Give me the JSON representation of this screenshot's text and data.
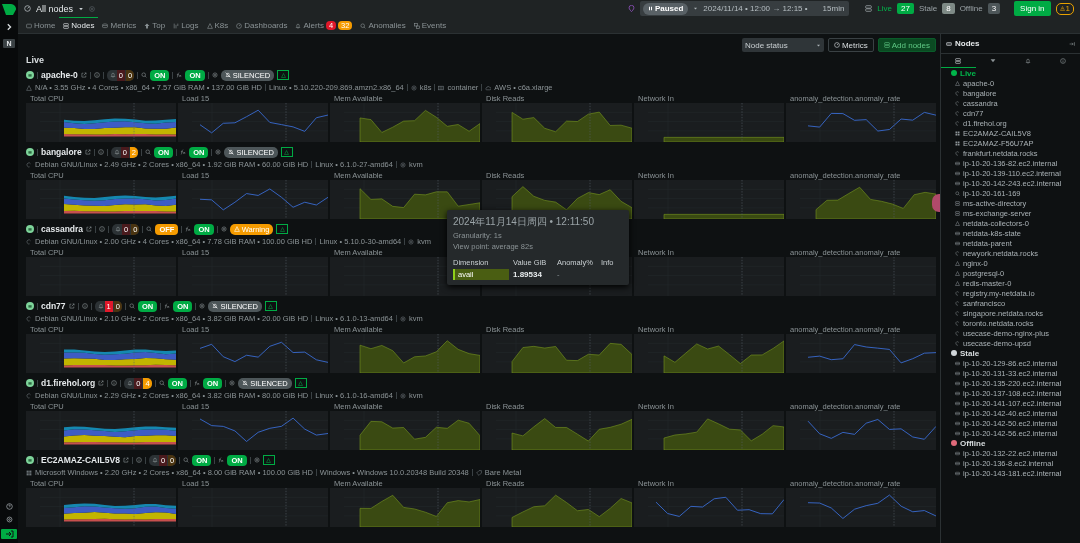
{
  "header": {
    "scope": "All nodes",
    "playback": {
      "label": "Paused",
      "paused": true
    },
    "range": "2024/11/14 • 12:00 → 12:15 •",
    "duration": "15min",
    "counts": [
      {
        "label": "Live",
        "value": "27",
        "kind": "live"
      },
      {
        "label": "Stale",
        "value": "8",
        "kind": "stale"
      },
      {
        "label": "Offline",
        "value": "3",
        "kind": "offline"
      }
    ],
    "sign_in": "Sign in",
    "warnings": "1"
  },
  "tabs": [
    {
      "label": "Home",
      "selected": false
    },
    {
      "label": "Nodes",
      "selected": true
    },
    {
      "label": "Metrics",
      "selected": false
    },
    {
      "label": "Top",
      "selected": false
    },
    {
      "label": "Logs",
      "selected": false
    },
    {
      "label": "K8s",
      "selected": false
    },
    {
      "label": "Dashboards",
      "selected": false
    },
    {
      "label": "Alerts",
      "selected": false,
      "badges": [
        {
          "text": "4",
          "kind": "critical"
        },
        {
          "text": "32",
          "kind": "warning"
        }
      ]
    },
    {
      "label": "Anomalies",
      "selected": false
    },
    {
      "label": "Events",
      "selected": false
    }
  ],
  "rail": {
    "space": "N"
  },
  "toolbar": {
    "group_by": "Node status",
    "metrics": "Metrics",
    "add_nodes": "Add nodes"
  },
  "section": "Live",
  "nodes": [
    {
      "name": "apache-0",
      "critical": {
        "count": "0",
        "active": false
      },
      "warning": {
        "count": "0",
        "active": false
      },
      "ml": {
        "label": "ON",
        "on": true
      },
      "fn": {
        "label": "ON",
        "on": true
      },
      "badge": {
        "kind": "silenced",
        "label": "SILENCED"
      },
      "info": [
        {
          "kind": "k8s",
          "text": "N/A • 3.55 GHz • 4 Cores • x86_64 • 7.57 GiB RAM • 137.00 GiB HD"
        },
        {
          "kind": "kernel",
          "text": "Linux • 5.10.220-209.869.amzn2.x86_64"
        },
        {
          "kind": "virt",
          "text": "k8s"
        },
        {
          "kind": "container",
          "text": "container"
        },
        {
          "kind": "cloud",
          "text": "AWS • c6a.xlarge"
        }
      ],
      "charts": [
        {
          "title": "Total CPU",
          "kind": "stacked"
        },
        {
          "title": "Load 15",
          "kind": "line"
        },
        {
          "title": "Mem Available",
          "kind": "area"
        },
        {
          "title": "Disk Reads",
          "kind": "area"
        },
        {
          "title": "Network In",
          "kind": "flat"
        },
        {
          "title": "anomaly_detection.anomaly_rate",
          "kind": "line"
        }
      ]
    },
    {
      "name": "bangalore",
      "critical": {
        "count": "0",
        "active": false
      },
      "warning": {
        "count": "2",
        "active": true
      },
      "ml": {
        "label": "ON",
        "on": true
      },
      "fn": {
        "label": "ON",
        "on": true
      },
      "badge": {
        "kind": "silenced",
        "label": "SILENCED"
      },
      "info": [
        {
          "kind": "debian",
          "text": "Debian GNU/Linux • 2.49 GHz • 2 Cores • x86_64 • 1.92 GiB RAM • 60.00 GiB HD"
        },
        {
          "kind": "kernel",
          "text": "Linux • 6.1.0-27-amd64"
        },
        {
          "kind": "virt",
          "text": "kvm"
        }
      ],
      "charts": [
        {
          "title": "Total CPU",
          "kind": "stacked"
        },
        {
          "title": "Load 15",
          "kind": "line"
        },
        {
          "title": "Mem Available",
          "kind": "area"
        },
        {
          "title": "Disk Reads",
          "kind": "area"
        },
        {
          "title": "Network In",
          "kind": "flat"
        },
        {
          "title": "anomaly_detection.anomaly_rate",
          "kind": "area"
        }
      ]
    },
    {
      "name": "cassandra",
      "critical": {
        "count": "0",
        "active": false
      },
      "warning": {
        "count": "0",
        "active": false
      },
      "ml": {
        "label": "OFF",
        "on": false
      },
      "fn": {
        "label": "ON",
        "on": true
      },
      "badge": {
        "kind": "warning",
        "label": "Warning"
      },
      "info": [
        {
          "kind": "debian",
          "text": "Debian GNU/Linux • 2.00 GHz • 4 Cores • x86_64 • 7.78 GiB RAM • 100.00 GiB HD"
        },
        {
          "kind": "kernel",
          "text": "Linux • 5.10.0-30-amd64"
        },
        {
          "kind": "virt",
          "text": "kvm"
        }
      ],
      "charts": [
        {
          "title": "Total CPU",
          "kind": "empty"
        },
        {
          "title": "Load 15",
          "kind": "empty"
        },
        {
          "title": "Mem Available",
          "kind": "empty"
        },
        {
          "kind": "empty"
        },
        {
          "title": "Network In",
          "kind": "empty"
        },
        {
          "title": "anomaly_detection.anomaly_rate",
          "kind": "empty"
        }
      ]
    },
    {
      "name": "cdn77",
      "critical": {
        "count": "1",
        "active": true
      },
      "warning": {
        "count": "0",
        "active": false
      },
      "ml": {
        "label": "ON",
        "on": true
      },
      "fn": {
        "label": "ON",
        "on": true
      },
      "badge": {
        "kind": "silenced",
        "label": "SILENCED"
      },
      "info": [
        {
          "kind": "debian",
          "text": "Debian GNU/Linux • 2.10 GHz • 2 Cores • x86_64 • 3.82 GiB RAM • 20.00 GiB HD"
        },
        {
          "kind": "kernel",
          "text": "Linux • 6.1.0-13-amd64"
        },
        {
          "kind": "virt",
          "text": "kvm"
        }
      ],
      "charts": [
        {
          "title": "Total CPU",
          "kind": "stacked"
        },
        {
          "title": "Load 15",
          "kind": "line"
        },
        {
          "title": "Mem Available",
          "kind": "area"
        },
        {
          "title": "Disk Reads",
          "kind": "area"
        },
        {
          "title": "Network In",
          "kind": "area"
        },
        {
          "title": "anomaly_detection.anomaly_rate",
          "kind": "line"
        }
      ]
    },
    {
      "name": "d1.firehol.org",
      "critical": {
        "count": "0",
        "active": false
      },
      "warning": {
        "count": "4",
        "active": true
      },
      "ml": {
        "label": "ON",
        "on": true
      },
      "fn": {
        "label": "ON",
        "on": true
      },
      "badge": {
        "kind": "silenced",
        "label": "SILENCED"
      },
      "info": [
        {
          "kind": "debian",
          "text": "Debian GNU/Linux • 2.29 GHz • 2 Cores • x86_64 • 3.82 GiB RAM • 80.00 GiB HD"
        },
        {
          "kind": "kernel",
          "text": "Linux • 6.1.0-16-amd64"
        },
        {
          "kind": "virt",
          "text": "kvm"
        }
      ],
      "charts": [
        {
          "title": "Total CPU",
          "kind": "stacked"
        },
        {
          "title": "Load 15",
          "kind": "line"
        },
        {
          "title": "Mem Available",
          "kind": "area"
        },
        {
          "title": "Disk Reads",
          "kind": "area"
        },
        {
          "title": "Network In",
          "kind": "area"
        },
        {
          "title": "anomaly_detection.anomaly_rate",
          "kind": "line"
        }
      ]
    },
    {
      "name": "EC2AMAZ-CAIL5V8",
      "critical": {
        "count": "0",
        "active": false
      },
      "warning": {
        "count": "0",
        "active": false
      },
      "ml": {
        "label": "ON",
        "on": true
      },
      "fn": {
        "label": "ON",
        "on": true
      },
      "info": [
        {
          "kind": "windows",
          "text": "Microsoft Windows • 2.20 GHz • 2 Cores • x86_64 • 8.00 GiB RAM • 100.00 GiB HD"
        },
        {
          "kind": "kernel",
          "text": "Windows • Windows 10.0.20348 Build 20348"
        },
        {
          "kind": "tag",
          "text": "Bare Metal"
        }
      ],
      "charts": [
        {
          "title": "Total CPU",
          "kind": "stacked"
        },
        {
          "title": "Load 15",
          "kind": "empty"
        },
        {
          "title": "Mem Available",
          "kind": "area"
        },
        {
          "title": "Disk Reads",
          "kind": "area"
        },
        {
          "title": "Network In",
          "kind": "line"
        },
        {
          "title": "anomaly_detection.anomaly_rate",
          "kind": "line"
        }
      ]
    }
  ],
  "tooltip": {
    "time": "2024年11月14日周四 • 12:11:50",
    "granularity": "Granularity: 1s",
    "view_point": "View point: average 82s",
    "columns": [
      "Dimension",
      "Value GiB",
      "Anomaly%",
      "Info"
    ],
    "row": {
      "dimension": "avail",
      "value": "1.89534",
      "anomaly": "-"
    }
  },
  "sidebar": {
    "title": "Nodes",
    "tabs": [
      {
        "selected": true
      },
      {
        "selected": false
      },
      {
        "selected": false
      },
      {
        "selected": false
      }
    ],
    "groups": [
      {
        "label": "Live",
        "kind": "live",
        "items": [
          {
            "name": "apache-0",
            "kind": "k8s"
          },
          {
            "name": "bangalore",
            "kind": "debian"
          },
          {
            "name": "cassandra",
            "kind": "debian"
          },
          {
            "name": "cdn77",
            "kind": "debian"
          },
          {
            "name": "d1.firehol.org",
            "kind": "debian"
          },
          {
            "name": "EC2AMAZ-CAIL5V8",
            "kind": "windows"
          },
          {
            "name": "EC2AMAZ-F56U7AP",
            "kind": "windows"
          },
          {
            "name": "frankfurt.netdata.rocks",
            "kind": "debian"
          },
          {
            "name": "ip-10-20-136-82.ec2.internal",
            "kind": "vm"
          },
          {
            "name": "ip-10-20-139-110.ec2.internal",
            "kind": "vm"
          },
          {
            "name": "ip-10-20-142-243.ec2.internal",
            "kind": "vm"
          },
          {
            "name": "ip-10-20-161-169",
            "kind": "probe"
          },
          {
            "name": "ms-active-directory",
            "kind": "server"
          },
          {
            "name": "ms-exchange-server",
            "kind": "server"
          },
          {
            "name": "netdata-collectors-0",
            "kind": "k8s"
          },
          {
            "name": "netdata-k8s-state",
            "kind": "vm"
          },
          {
            "name": "netdata-parent",
            "kind": "vm"
          },
          {
            "name": "newyork.netdata.rocks",
            "kind": "debian"
          },
          {
            "name": "nginx-0",
            "kind": "k8s"
          },
          {
            "name": "postgresql-0",
            "kind": "k8s"
          },
          {
            "name": "redis-master-0",
            "kind": "k8s"
          },
          {
            "name": "registry.my-netdata.io",
            "kind": "debian"
          },
          {
            "name": "sanfrancisco",
            "kind": "debian"
          },
          {
            "name": "singapore.netdata.rocks",
            "kind": "debian"
          },
          {
            "name": "toronto.netdata.rocks",
            "kind": "debian"
          },
          {
            "name": "usecase-demo-nginx-plus",
            "kind": "debian"
          },
          {
            "name": "usecase-demo-upsd",
            "kind": "debian"
          }
        ]
      },
      {
        "label": "Stale",
        "kind": "stale",
        "items": [
          {
            "name": "ip-10-20-129-86.ec2.internal",
            "kind": "vm"
          },
          {
            "name": "ip-10-20-131-33.ec2.internal",
            "kind": "vm"
          },
          {
            "name": "ip-10-20-135-220.ec2.internal",
            "kind": "vm"
          },
          {
            "name": "ip-10-20-137-108.ec2.internal",
            "kind": "vm"
          },
          {
            "name": "ip-10-20-141-107.ec2.internal",
            "kind": "vm"
          },
          {
            "name": "ip-10-20-142-40.ec2.internal",
            "kind": "vm"
          },
          {
            "name": "ip-10-20-142-50.ec2.internal",
            "kind": "vm"
          },
          {
            "name": "ip-10-20-142-56.ec2.internal",
            "kind": "vm"
          }
        ]
      },
      {
        "label": "Offline",
        "kind": "offline",
        "items": [
          {
            "name": "ip-10-20-132-22.ec2.internal",
            "kind": "vm"
          },
          {
            "name": "ip-10-20-136-8.ec2.internal",
            "kind": "vm"
          },
          {
            "name": "ip-10-20-143-181.ec2.internal",
            "kind": "vm"
          }
        ]
      }
    ]
  }
}
